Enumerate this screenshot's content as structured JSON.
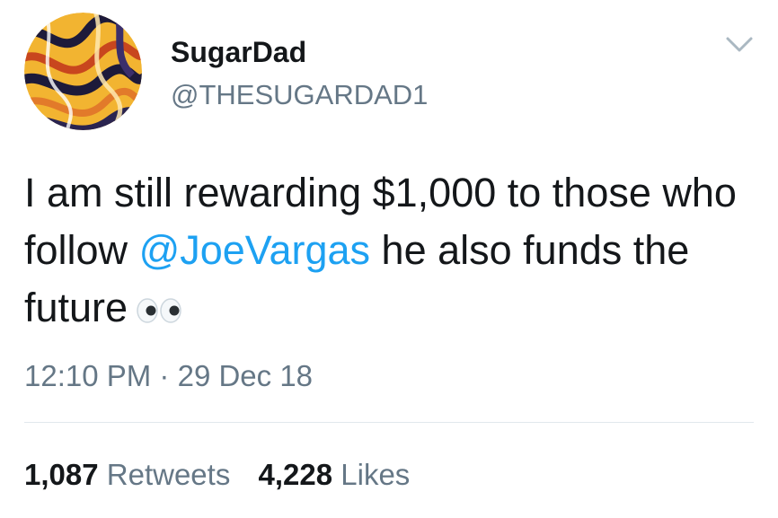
{
  "user": {
    "display_name": "SugarDad",
    "handle": "@THESUGARDAD1"
  },
  "tweet": {
    "text_before": "I am still rewarding $1,000 to those who follow ",
    "mention": "@JoeVargas",
    "text_after": " he also funds the future",
    "emoji": "eyes-icon",
    "time": "12:10 PM",
    "separator": "·",
    "date": "29 Dec 18"
  },
  "stats": {
    "retweets_count": "1,087",
    "retweets_label": "Retweets",
    "likes_count": "4,228",
    "likes_label": "Likes"
  },
  "colors": {
    "mention": "#1da1f2",
    "secondary_text": "#657786",
    "primary_text": "#14171a",
    "divider": "#e1e8ed"
  }
}
